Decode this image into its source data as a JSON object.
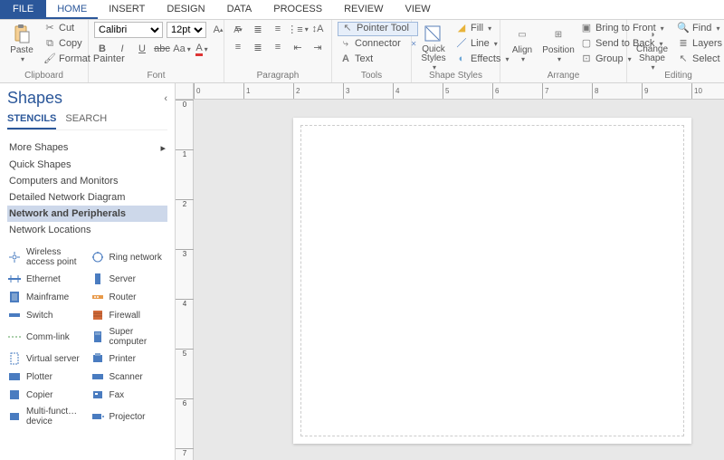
{
  "tabs": {
    "file": "FILE",
    "home": "HOME",
    "insert": "INSERT",
    "design": "DESIGN",
    "data": "DATA",
    "process": "PROCESS",
    "review": "REVIEW",
    "view": "VIEW"
  },
  "ribbon": {
    "clipboard": {
      "label": "Clipboard",
      "paste": "Paste",
      "cut": "Cut",
      "copy": "Copy",
      "format_painter": "Format Painter"
    },
    "font": {
      "label": "Font",
      "family": "Calibri",
      "size": "12pt."
    },
    "paragraph": {
      "label": "Paragraph"
    },
    "tools": {
      "label": "Tools",
      "pointer": "Pointer Tool",
      "connector": "Connector",
      "text": "Text"
    },
    "shape_styles": {
      "label": "Shape Styles",
      "quick": "Quick Styles",
      "fill": "Fill",
      "line": "Line",
      "effects": "Effects"
    },
    "arrange": {
      "label": "Arrange",
      "align": "Align",
      "position": "Position",
      "bring_front": "Bring to Front",
      "send_back": "Send to Back",
      "group": "Group"
    },
    "editing": {
      "label": "Editing",
      "change_shape": "Change Shape",
      "find": "Find",
      "layers": "Layers",
      "select": "Select"
    }
  },
  "panel": {
    "title": "Shapes",
    "tab_stencils": "STENCILS",
    "tab_search": "SEARCH",
    "stencils": {
      "more": "More Shapes",
      "quick": "Quick Shapes",
      "computers": "Computers and Monitors",
      "detailed": "Detailed Network Diagram",
      "network_periph": "Network and Peripherals",
      "network_loc": "Network Locations"
    },
    "shapes": [
      {
        "name": "Wireless access point"
      },
      {
        "name": "Ring network"
      },
      {
        "name": "Ethernet"
      },
      {
        "name": "Server"
      },
      {
        "name": "Mainframe"
      },
      {
        "name": "Router"
      },
      {
        "name": "Switch"
      },
      {
        "name": "Firewall"
      },
      {
        "name": "Comm-link"
      },
      {
        "name": "Super computer"
      },
      {
        "name": "Virtual server"
      },
      {
        "name": "Printer"
      },
      {
        "name": "Plotter"
      },
      {
        "name": "Scanner"
      },
      {
        "name": "Copier"
      },
      {
        "name": "Fax"
      },
      {
        "name": "Multi-funct… device"
      },
      {
        "name": "Projector"
      }
    ]
  },
  "ruler_h": [
    "0",
    "1",
    "2",
    "3",
    "4",
    "5",
    "6",
    "7",
    "8",
    "9",
    "10"
  ],
  "ruler_v": [
    "0",
    "1",
    "2",
    "3",
    "4",
    "5",
    "6",
    "7"
  ]
}
